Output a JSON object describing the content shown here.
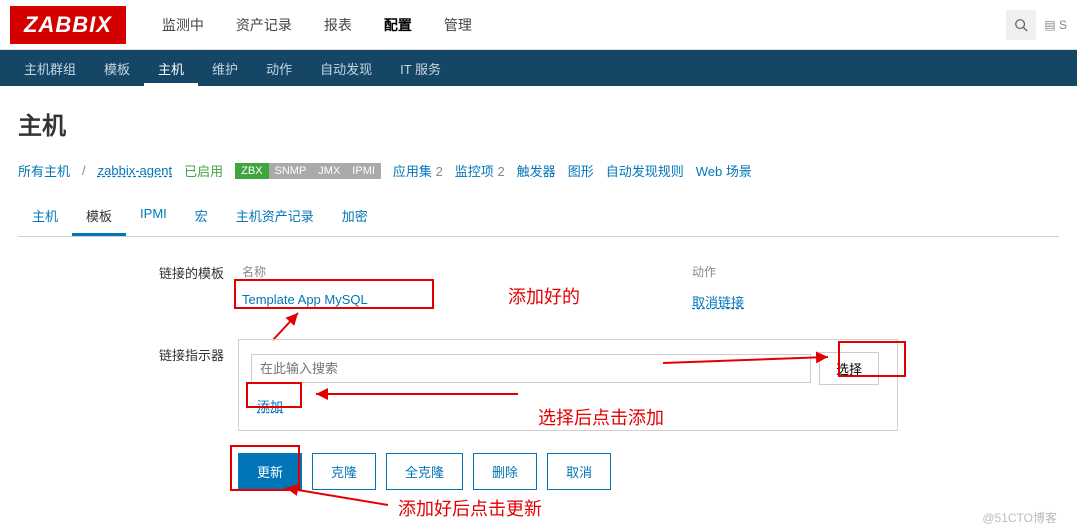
{
  "logo": "ZABBIX",
  "mainNav": {
    "monitoring": "监测中",
    "inventory": "资产记录",
    "reports": "报表",
    "configuration": "配置",
    "administration": "管理"
  },
  "subNav": {
    "hostGroups": "主机群组",
    "templates": "模板",
    "hosts": "主机",
    "maintenance": "维护",
    "actions": "动作",
    "discovery": "自动发现",
    "itServices": "IT 服务"
  },
  "pageTitle": "主机",
  "breadcrumb": {
    "allHosts": "所有主机",
    "hostName": "zabbix-agent",
    "status": "已启用",
    "tags": {
      "zbx": "ZBX",
      "snmp": "SNMP",
      "jmx": "JMX",
      "ipmi": "IPMI"
    },
    "apps": "应用集",
    "appsCount": "2",
    "items": "监控项",
    "itemsCount": "2",
    "triggers": "触发器",
    "graphs": "图形",
    "discoveryRules": "自动发现规则",
    "webScenarios": "Web 场景"
  },
  "tabs": {
    "host": "主机",
    "templates": "模板",
    "ipmi": "IPMI",
    "macros": "宏",
    "hostInventory": "主机资产记录",
    "encryption": "加密"
  },
  "form": {
    "linkedTemplatesLabel": "链接的模板",
    "nameHeader": "名称",
    "actionHeader": "动作",
    "templateName": "Template App MySQL",
    "unlink": "取消链接",
    "linkIndicatorLabel": "链接指示器",
    "searchPlaceholder": "在此输入搜索",
    "selectButton": "选择",
    "addLink": "添加"
  },
  "buttons": {
    "update": "更新",
    "clone": "克隆",
    "fullClone": "全克隆",
    "delete": "删除",
    "cancel": "取消"
  },
  "annotations": {
    "addedOne": "添加好的",
    "selectThenAdd": "选择后点击添加",
    "updateAfterAdd": "添加好后点击更新"
  },
  "watermark": "@51CTO博客",
  "share": "S"
}
